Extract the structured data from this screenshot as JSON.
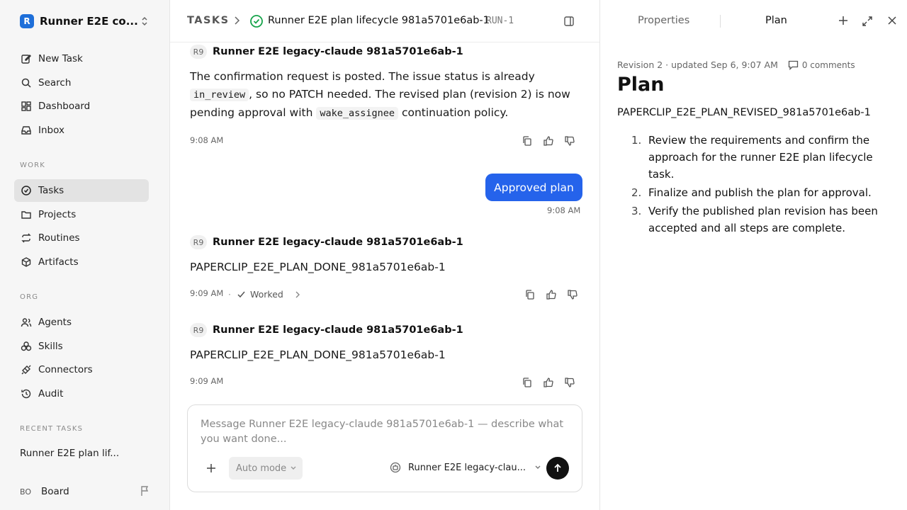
{
  "sidebar": {
    "workspace_initial": "R",
    "workspace_name": "Runner E2E co...",
    "nav_top": [
      {
        "label": "New Task",
        "icon": "edit-icon"
      },
      {
        "label": "Search",
        "icon": "search-icon"
      },
      {
        "label": "Dashboard",
        "icon": "dashboard-icon"
      },
      {
        "label": "Inbox",
        "icon": "inbox-icon"
      }
    ],
    "work_label": "WORK",
    "nav_work": [
      {
        "label": "Tasks",
        "icon": "check-circle-icon",
        "active": true
      },
      {
        "label": "Projects",
        "icon": "folder-icon"
      },
      {
        "label": "Routines",
        "icon": "repeat-icon"
      },
      {
        "label": "Artifacts",
        "icon": "box-icon"
      }
    ],
    "org_label": "ORG",
    "nav_org": [
      {
        "label": "Agents",
        "icon": "users-icon"
      },
      {
        "label": "Skills",
        "icon": "skills-icon"
      },
      {
        "label": "Connectors",
        "icon": "plug-icon"
      },
      {
        "label": "Audit",
        "icon": "history-icon"
      }
    ],
    "recent_label": "RECENT TASKS",
    "recent_tasks": [
      "Runner E2E plan lif..."
    ],
    "board_avatar": "BO",
    "board_label": "Board"
  },
  "header": {
    "root": "TASKS",
    "title": "Runner E2E plan lifecycle 981a5701e6ab-1",
    "run_id": "RUN-1"
  },
  "messages": [
    {
      "badge": "R9",
      "author": "Runner E2E legacy-claude 981a5701e6ab-1",
      "text_1": "The confirmation request is posted. The issue status is already",
      "code_1": "in_review",
      "text_2": ", so no PATCH needed. The revised plan (revision 2) is now pending approval with",
      "code_2": "wake_assignee",
      "text_3": "continuation policy.",
      "time": "9:08 AM"
    },
    {
      "badge": "R9",
      "author": "Runner E2E legacy-claude 981a5701e6ab-1",
      "text": "PAPERCLIP_E2E_PLAN_DONE_981a5701e6ab-1",
      "time": "9:09 AM",
      "worked": "Worked"
    },
    {
      "badge": "R9",
      "author": "Runner E2E legacy-claude 981a5701e6ab-1",
      "text": "PAPERCLIP_E2E_PLAN_DONE_981a5701e6ab-1",
      "time": "9:09 AM"
    }
  ],
  "user_message": {
    "text": "Approved plan",
    "time": "9:08 AM"
  },
  "composer": {
    "placeholder": "Message Runner E2E legacy-claude 981a5701e6ab-1 — describe what you want done...",
    "mode": "Auto mode",
    "agent": "Runner E2E legacy-clau..."
  },
  "right_panel": {
    "tabs": [
      "Properties",
      "Plan"
    ],
    "active_tab": "Plan",
    "revision_meta": "Revision 2 · updated Sep 6, 9:07 AM",
    "comments": "0 comments",
    "title": "Plan",
    "code": "PAPERCLIP_E2E_PLAN_REVISED_981a5701e6ab-1",
    "steps": [
      {
        "num": "1.",
        "text": "Review the requirements and confirm the approach for the runner E2E plan lifecycle task."
      },
      {
        "num": "2.",
        "text": "Finalize and publish the plan for approval."
      },
      {
        "num": "3.",
        "text": "Verify the published plan revision has been accepted and all steps are complete."
      }
    ]
  },
  "colors": {
    "accent": "#2563eb",
    "success": "#16a34a",
    "sidebar_bg": "#f6f6f6",
    "active_item": "#e3e3e3"
  }
}
